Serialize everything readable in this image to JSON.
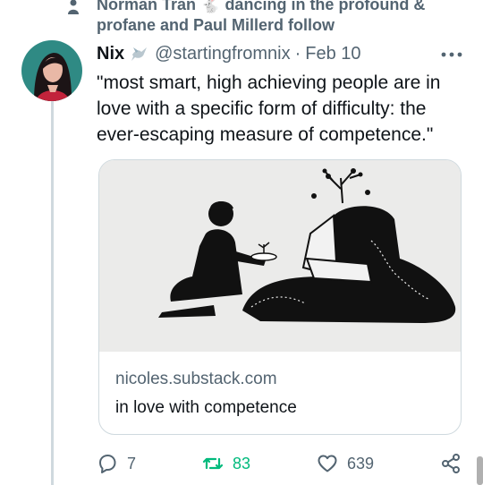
{
  "social_context": {
    "icon": "person-icon",
    "text": "Norman Tran 🐇 dancing in the profound & profane and Paul Millerd follow"
  },
  "tweet": {
    "avatar": "avatar-woman",
    "name": "Nix",
    "name_emoji": "dove-icon",
    "handle": "@startingfromnix",
    "separator": "·",
    "date": "Feb 10",
    "text": "\"most smart, high achieving people are in love with a specific form of difficulty: the ever-escaping measure of competence.\"",
    "more_icon": "more-icon"
  },
  "card": {
    "image": "illustration-kneeling-figure-offering-sprout",
    "domain": "nicoles.substack.com",
    "title": "in love with competence"
  },
  "actions": {
    "reply": {
      "icon": "reply-icon",
      "count": "7"
    },
    "retweet": {
      "icon": "retweet-icon",
      "count": "83"
    },
    "like": {
      "icon": "heart-icon",
      "count": "639"
    },
    "share": {
      "icon": "share-icon"
    }
  },
  "colors": {
    "text_primary": "#0f1419",
    "text_secondary": "#536471",
    "retweet": "#00ba7c",
    "border": "#cfd9de"
  }
}
